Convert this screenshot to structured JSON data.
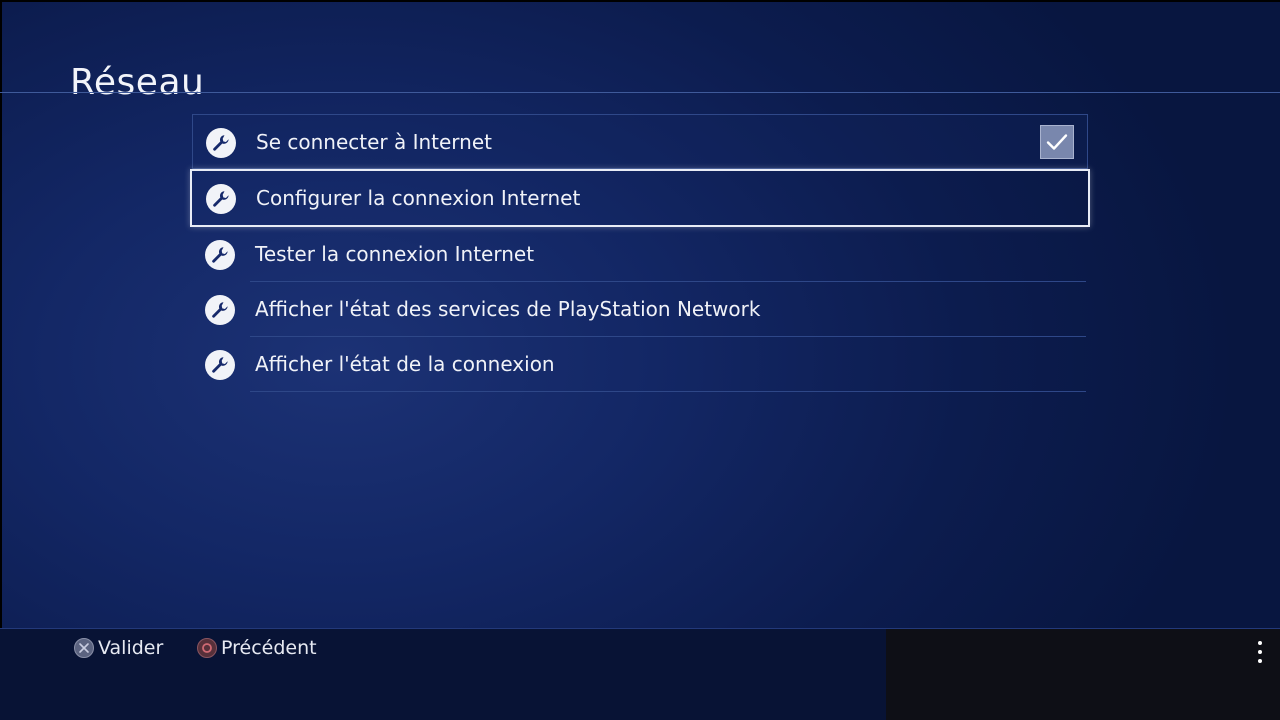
{
  "screen": {
    "title": "Réseau"
  },
  "menu": {
    "items": [
      {
        "label": "Se connecter à Internet",
        "icon": "wrench-icon",
        "checked": true
      },
      {
        "label": "Configurer la connexion Internet",
        "icon": "wrench-icon",
        "selected": true
      },
      {
        "label": "Tester la connexion Internet",
        "icon": "wrench-icon"
      },
      {
        "label": "Afficher l'état des services de PlayStation Network",
        "icon": "wrench-icon"
      },
      {
        "label": "Afficher l'état de la connexion",
        "icon": "wrench-icon"
      }
    ]
  },
  "footer": {
    "confirm": {
      "icon": "cross-button-icon",
      "label": "Valider"
    },
    "back": {
      "icon": "circle-button-icon",
      "label": "Précédent"
    },
    "options_icon": "options-menu-icon"
  },
  "colors": {
    "background": "#132765",
    "accent_text": "#ffffff",
    "checkbox": "#7987ad"
  }
}
